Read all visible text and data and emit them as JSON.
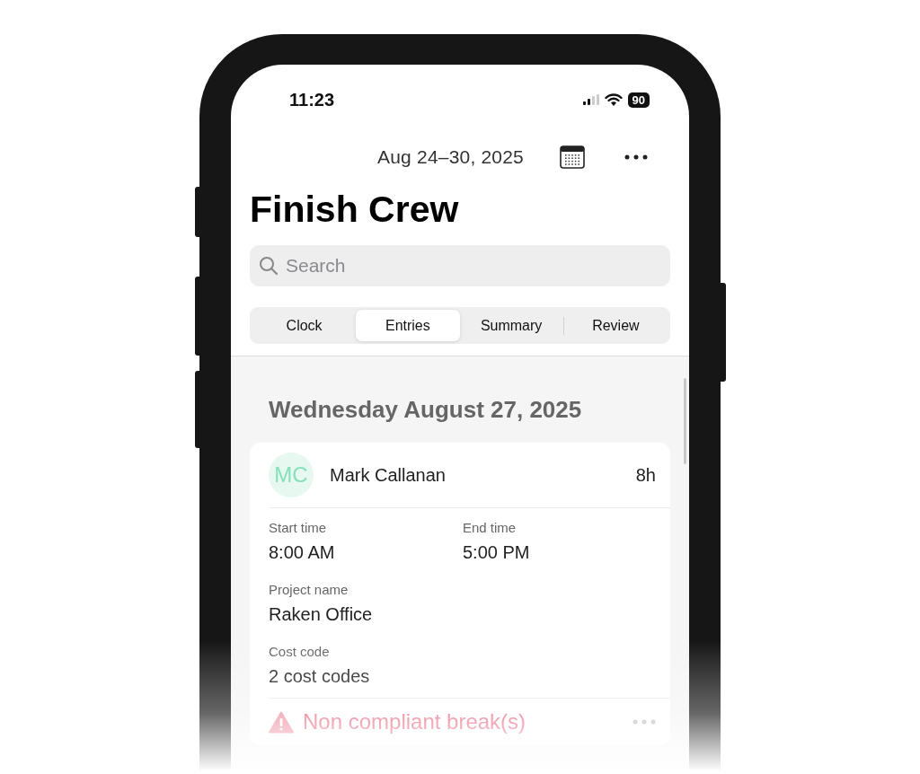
{
  "status_bar": {
    "time": "11:23",
    "battery": "90"
  },
  "header": {
    "date_range": "Aug 24–30, 2025"
  },
  "title": "Finish Crew",
  "search": {
    "placeholder": "Search"
  },
  "tabs": [
    {
      "label": "Clock",
      "selected": false
    },
    {
      "label": "Entries",
      "selected": true
    },
    {
      "label": "Summary",
      "selected": false
    },
    {
      "label": "Review",
      "selected": false
    }
  ],
  "day_heading": "Wednesday August 27, 2025",
  "entries": [
    {
      "initials": "MC",
      "name": "Mark Callanan",
      "hours": "8h",
      "fields": [
        {
          "kind": "half",
          "label": "Start time",
          "value": "8:00 AM"
        },
        {
          "kind": "half",
          "label": "End time",
          "value": "5:00 PM"
        },
        {
          "kind": "full",
          "label": "Project name",
          "value": "Raken Office"
        },
        {
          "kind": "full",
          "label": "Cost code",
          "value": "2 cost codes"
        }
      ],
      "warning": "Non compliant break(s)"
    }
  ]
}
